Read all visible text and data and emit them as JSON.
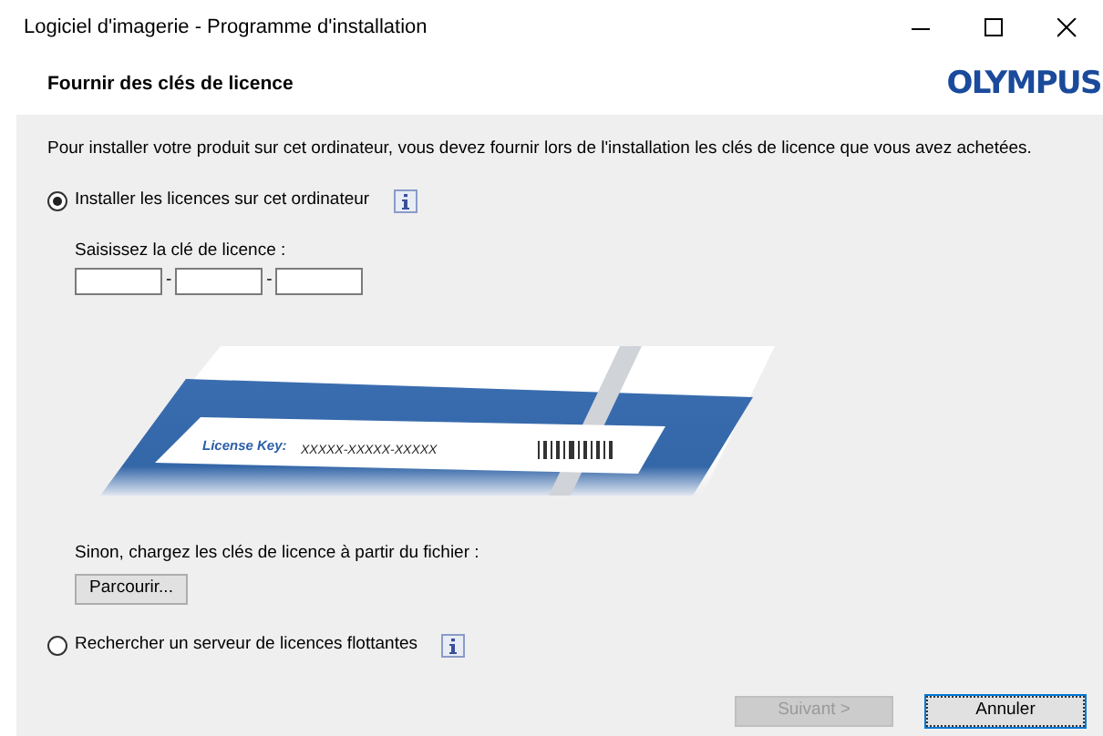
{
  "window": {
    "title": "Logiciel d'imagerie - Programme d'installation"
  },
  "header": {
    "title": "Fournir des clés de licence",
    "logo": "OLYMPUS"
  },
  "intro": "Pour installer votre produit sur cet ordinateur, vous devez fournir lors de l'installation les clés de licence que vous avez achetées.",
  "options": [
    {
      "label": "Installer les licences sur cet ordinateur",
      "selected": true
    },
    {
      "label": "Rechercher un serveur de licences flottantes",
      "selected": false
    }
  ],
  "key_entry": {
    "label": "Saisissez la clé de licence :",
    "fields": [
      {
        "kind": "blank"
      },
      {
        "kind": "blank"
      },
      {
        "kind": "blank"
      }
    ],
    "separator": "-"
  },
  "card": {
    "key_label": "License Key:",
    "key_value": "XXXXX-XXXXX-XXXXX"
  },
  "file_prompt": "Sinon, chargez les clés de licence à partir du fichier :",
  "browse_button": "Parcourir...",
  "buttons": [
    {
      "label": "Suivant >",
      "disabled": true
    },
    {
      "label": "Annuler",
      "disabled": false
    }
  ]
}
